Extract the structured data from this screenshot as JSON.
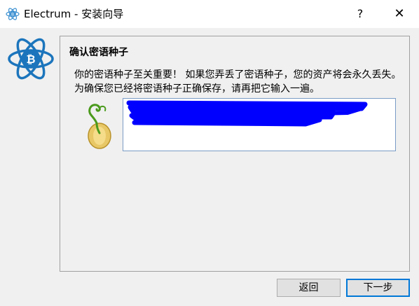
{
  "window": {
    "title": "Electrum  -  安装向导",
    "help_label": "?",
    "close_label": "✕"
  },
  "page": {
    "heading": "确认密语种子",
    "message": "你的密语种子至关重要！ 如果您弄丢了密语种子，您的资产将会永久丢失。 为确保您已经将密语种子正确保存，请再把它输入一遍。"
  },
  "seed_input": {
    "value": "",
    "redacted": true
  },
  "buttons": {
    "back_label": "返回",
    "next_label": "下一步"
  },
  "colors": {
    "accent": "#0078d7",
    "electrum_blue": "#1c75bc",
    "redaction": "#0000ff"
  },
  "icons": {
    "app": "electrum-logo-icon",
    "page": "electrum-logo-icon",
    "seed": "seed-sprout-icon"
  }
}
